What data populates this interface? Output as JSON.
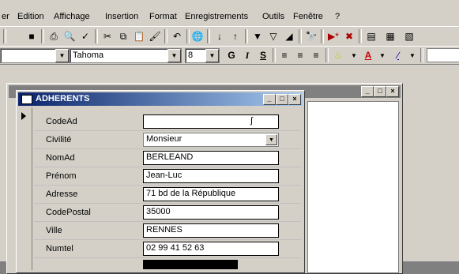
{
  "menubar": {
    "items": [
      "er",
      "Edition",
      "Affichage",
      "Insertion",
      "Format",
      "Enregistrements",
      "Outils",
      "Fenêtre",
      "?"
    ]
  },
  "format_toolbar": {
    "font_name": "Tahoma",
    "font_size": "8",
    "bold": "G",
    "italic": "I",
    "underline": "S"
  },
  "background_window": {
    "title": ""
  },
  "form_window": {
    "title": "ADHERENTS",
    "fields": [
      {
        "label": "CodeAd",
        "value": ""
      },
      {
        "label": "Civilité",
        "value": "Monsieur"
      },
      {
        "label": "NomAd",
        "value": "BERLEAND"
      },
      {
        "label": "Prénom",
        "value": "Jean-Luc"
      },
      {
        "label": "Adresse",
        "value": "71 bd de la République"
      },
      {
        "label": "CodePostal",
        "value": "35000"
      },
      {
        "label": "Ville",
        "value": "RENNES"
      },
      {
        "label": "Numtel",
        "value": "02 99 41 52 63"
      }
    ]
  }
}
